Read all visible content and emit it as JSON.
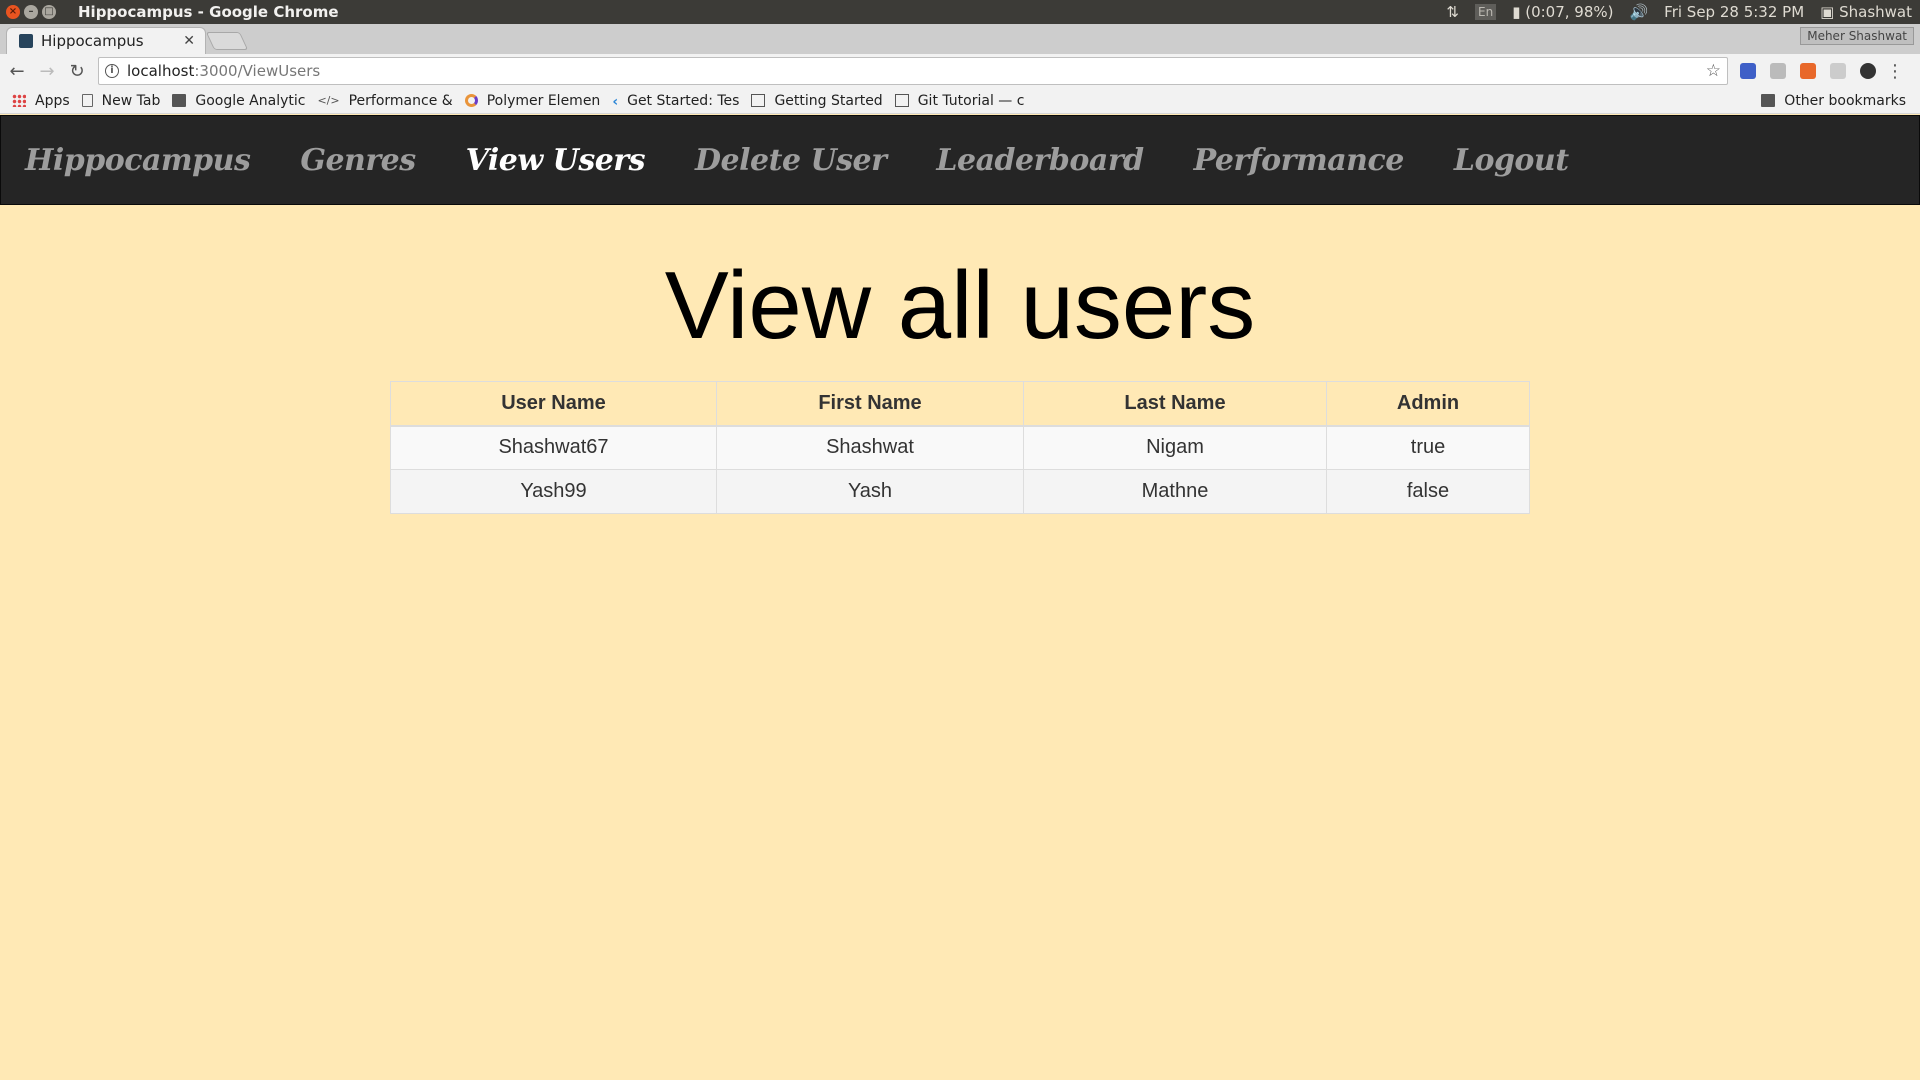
{
  "os": {
    "window_title": "Hippocampus - Google Chrome",
    "lang": "En",
    "battery": "(0:07, 98%)",
    "datetime": "Fri Sep 28  5:32 PM",
    "user": "Shashwat"
  },
  "browser": {
    "tab_title": "Hippocampus",
    "profile": "Meher Shashwat",
    "url_host": "localhost",
    "url_path": ":3000/ViewUsers",
    "bookmarks": [
      {
        "label": "Apps",
        "icon": "apps-grid-icon"
      },
      {
        "label": "New Tab",
        "icon": "page-icon"
      },
      {
        "label": "Google Analytic",
        "icon": "folder-icon"
      },
      {
        "label": "Performance &",
        "icon": "code-icon"
      },
      {
        "label": "Polymer Elemen",
        "icon": "polymer-icon"
      },
      {
        "label": "Get Started: Tes",
        "icon": "flutter-icon"
      },
      {
        "label": "Getting Started",
        "icon": "doc-icon"
      },
      {
        "label": "Git Tutorial — c",
        "icon": "doc-icon"
      }
    ],
    "other_bookmarks": "Other bookmarks"
  },
  "nav": {
    "brand": "Hippocampus",
    "links": [
      "Genres",
      "View Users",
      "Delete User",
      "Leaderboard",
      "Performance",
      "Logout"
    ],
    "active": "View Users"
  },
  "page": {
    "heading": "View all users"
  },
  "table": {
    "headers": [
      "User Name",
      "First Name",
      "Last Name",
      "Admin"
    ],
    "rows": [
      [
        "Shashwat67",
        "Shashwat",
        "Nigam",
        "true"
      ],
      [
        "Yash99",
        "Yash",
        "Mathne",
        "false"
      ]
    ]
  },
  "colors": {
    "page_bg": "#ffe9b5",
    "navbar_bg": "#252525",
    "nav_link": "#9d9d9d",
    "nav_active": "#ffffff"
  }
}
